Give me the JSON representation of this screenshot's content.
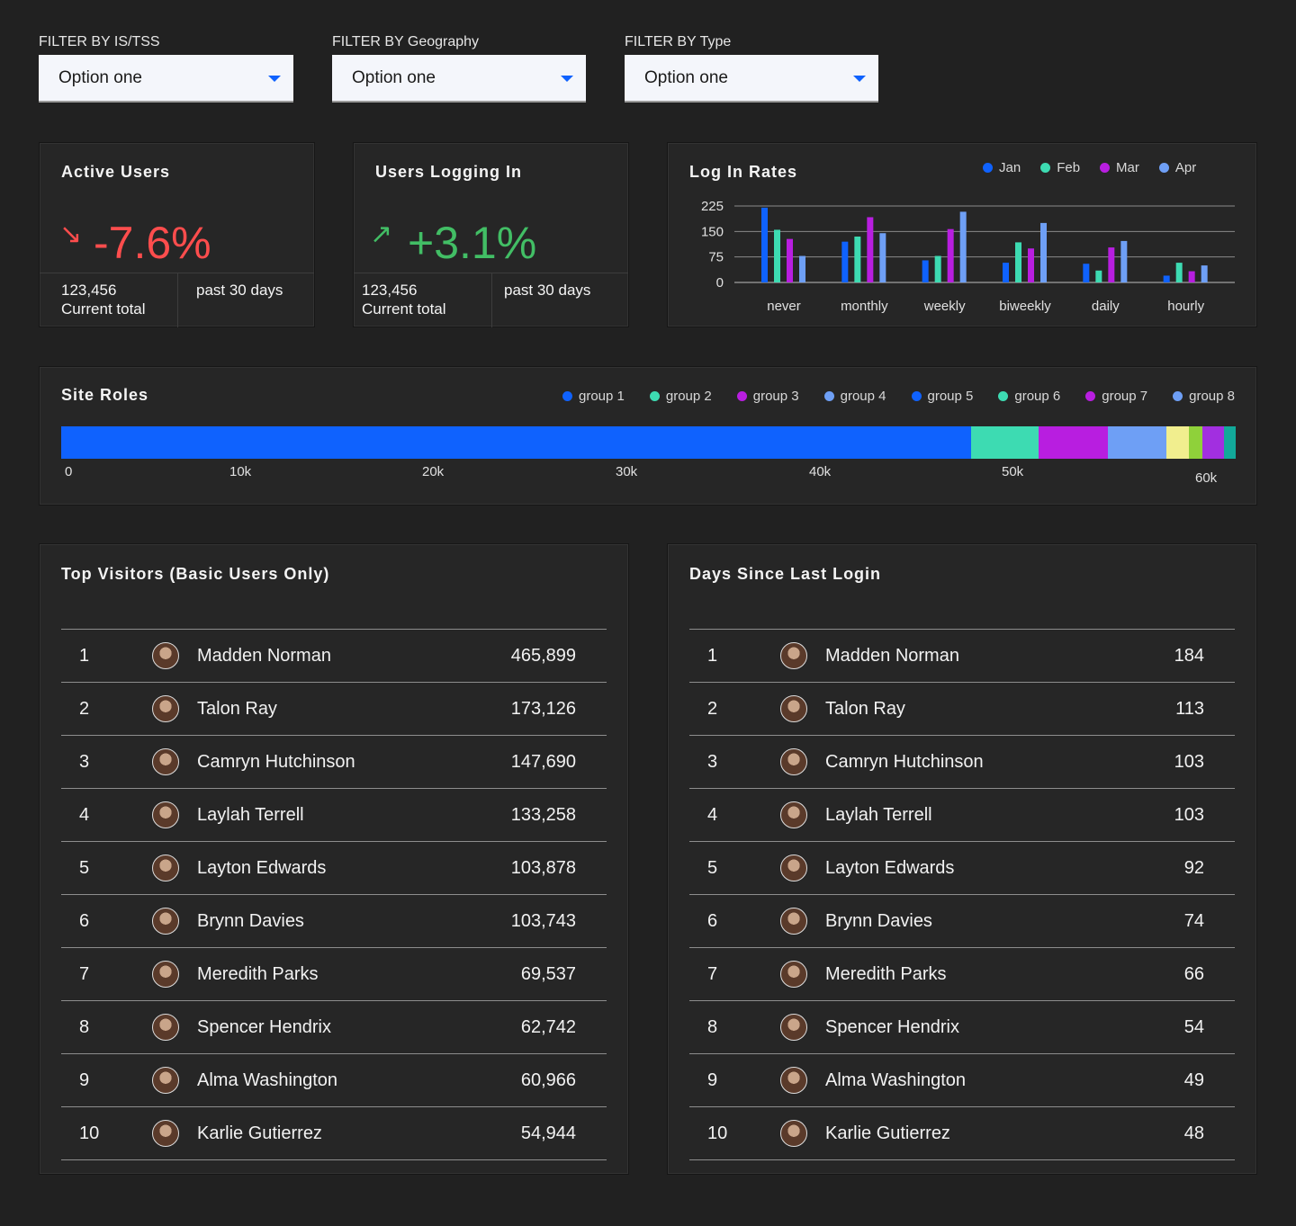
{
  "filters": [
    {
      "label": "FILTER BY IS/TSS",
      "value": "Option one"
    },
    {
      "label": "FILTER BY Geography",
      "value": "Option one"
    },
    {
      "label": "FILTER BY Type",
      "value": "Option one"
    }
  ],
  "kpis": {
    "active_users": {
      "title": "Active Users",
      "arrow": "↘",
      "value": "-7.6%",
      "total": "123,456",
      "total_label": "Current total",
      "period": "past 30 days"
    },
    "users_logging_in": {
      "title": "Users Logging In",
      "arrow": "↗",
      "value": "+3.1%",
      "total": "123,456",
      "total_label": "Current total",
      "period": "past 30 days"
    }
  },
  "colors": {
    "blue": "#0f62fe",
    "teal": "#3ddbb2",
    "purple": "#b81ee0",
    "light_blue": "#6e9ff5",
    "negative": "#ff4d4d",
    "positive": "#42be65",
    "yellow": "#f1ee8e"
  },
  "chart_data": [
    {
      "title": "Log In Rates",
      "type": "bar",
      "categories": [
        "never",
        "monthly",
        "weekly",
        "biweekly",
        "daily",
        "hourly"
      ],
      "series": [
        {
          "name": "Jan",
          "color": "#0f62fe",
          "values": [
            220,
            120,
            65,
            58,
            55,
            20
          ]
        },
        {
          "name": "Feb",
          "color": "#3ddbb2",
          "values": [
            155,
            135,
            78,
            118,
            35,
            58
          ]
        },
        {
          "name": "Mar",
          "color": "#b81ee0",
          "values": [
            128,
            192,
            157,
            100,
            103,
            33
          ]
        },
        {
          "name": "Apr",
          "color": "#6e9ff5",
          "values": [
            78,
            145,
            208,
            175,
            122,
            50
          ]
        }
      ],
      "yticks": [
        0,
        75,
        150,
        225
      ],
      "ylim": [
        0,
        225
      ],
      "grid": true,
      "legend": "top-right"
    },
    {
      "title": "Site Roles",
      "type": "bar",
      "stacked": true,
      "orientation": "horizontal",
      "series": [
        {
          "name": "group 1",
          "color": "#0f62fe",
          "value": 47100
        },
        {
          "name": "group 2",
          "color": "#3ddbb2",
          "value": 3500
        },
        {
          "name": "group 3",
          "color": "#b81ee0",
          "value": 3600
        },
        {
          "name": "group 4",
          "color": "#6e9ff5",
          "value": 3000
        },
        {
          "name": "group 5",
          "color": "#f1ee8e",
          "value": 1200
        },
        {
          "name": "group 6",
          "color": "#8fd13a",
          "value": 700
        },
        {
          "name": "group 7",
          "color": "#a22fe0",
          "value": 1100
        },
        {
          "name": "group 8",
          "color": "#12a99a",
          "value": 600
        }
      ],
      "legend_colors": [
        "#0f62fe",
        "#3ddbb2",
        "#b81ee0",
        "#6e9ff5",
        "#0f62fe",
        "#3ddbb2",
        "#b81ee0",
        "#6e9ff5"
      ],
      "xticks": [
        "0",
        "10k",
        "20k",
        "30k",
        "40k",
        "50k",
        "60k"
      ],
      "xlim": [
        0,
        60800
      ],
      "legend": "top-right"
    }
  ],
  "top_visitors": {
    "title": "Top Visitors (Basic Users Only)",
    "rows": [
      {
        "rank": "1",
        "name": "Madden Norman",
        "value": "465,899"
      },
      {
        "rank": "2",
        "name": "Talon Ray",
        "value": "173,126"
      },
      {
        "rank": "3",
        "name": "Camryn Hutchinson",
        "value": "147,690"
      },
      {
        "rank": "4",
        "name": "Laylah Terrell",
        "value": "133,258"
      },
      {
        "rank": "5",
        "name": "Layton Edwards",
        "value": "103,878"
      },
      {
        "rank": "6",
        "name": "Brynn Davies",
        "value": "103,743"
      },
      {
        "rank": "7",
        "name": "Meredith Parks",
        "value": "69,537"
      },
      {
        "rank": "8",
        "name": "Spencer Hendrix",
        "value": "62,742"
      },
      {
        "rank": "9",
        "name": "Alma Washington",
        "value": "60,966"
      },
      {
        "rank": "10",
        "name": "Karlie Gutierrez",
        "value": "54,944"
      }
    ]
  },
  "days_since_login": {
    "title": "Days Since Last Login",
    "rows": [
      {
        "rank": "1",
        "name": "Madden Norman",
        "value": "184"
      },
      {
        "rank": "2",
        "name": "Talon Ray",
        "value": "113"
      },
      {
        "rank": "3",
        "name": "Camryn Hutchinson",
        "value": "103"
      },
      {
        "rank": "4",
        "name": "Laylah Terrell",
        "value": "103"
      },
      {
        "rank": "5",
        "name": "Layton Edwards",
        "value": "92"
      },
      {
        "rank": "6",
        "name": "Brynn Davies",
        "value": "74"
      },
      {
        "rank": "7",
        "name": "Meredith Parks",
        "value": "66"
      },
      {
        "rank": "8",
        "name": "Spencer Hendrix",
        "value": "54"
      },
      {
        "rank": "9",
        "name": "Alma Washington",
        "value": "49"
      },
      {
        "rank": "10",
        "name": "Karlie Gutierrez",
        "value": "48"
      }
    ]
  }
}
